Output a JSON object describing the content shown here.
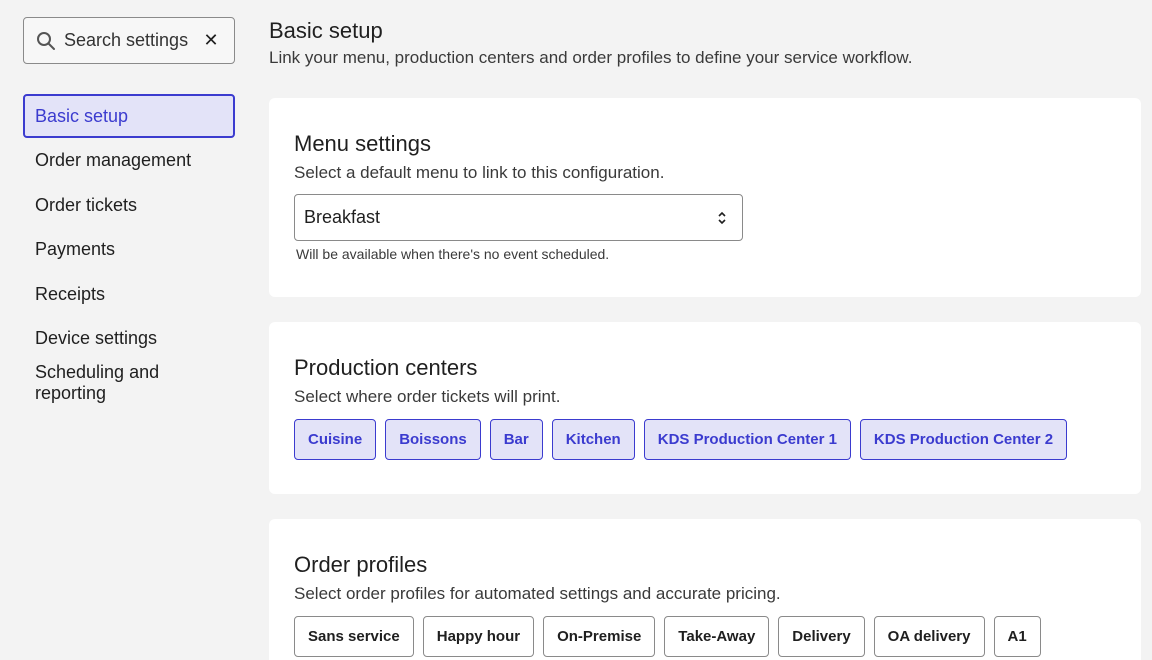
{
  "search": {
    "label": "Search settings",
    "clear_glyph": "✕"
  },
  "sidebar": {
    "items": [
      {
        "label": "Basic setup",
        "active": true
      },
      {
        "label": "Order management"
      },
      {
        "label": "Order tickets"
      },
      {
        "label": "Payments"
      },
      {
        "label": "Receipts"
      },
      {
        "label": "Device settings"
      },
      {
        "label": "Scheduling and reporting"
      }
    ]
  },
  "header": {
    "title": "Basic setup",
    "subtitle": "Link your menu, production centers and order profiles to define your service workflow."
  },
  "menu_settings": {
    "title": "Menu settings",
    "description": "Select a default menu to link to this configuration.",
    "selected_value": "Breakfast",
    "helper": "Will be available when there's no event scheduled."
  },
  "production_centers": {
    "title": "Production centers",
    "description": "Select where order tickets will print.",
    "chips": [
      "Cuisine",
      "Boissons",
      "Bar",
      "Kitchen",
      "KDS Production Center 1",
      "KDS Production Center 2"
    ]
  },
  "order_profiles": {
    "title": "Order profiles",
    "description": "Select order profiles for automated settings and accurate pricing.",
    "chips": [
      "Sans service",
      "Happy hour",
      "On-Premise",
      "Take-Away",
      "Delivery",
      "OA delivery",
      "A1"
    ]
  },
  "colors": {
    "accent": "#3b3bcf",
    "accent_bg": "#e3e3f8",
    "page_bg": "#f3f3f3"
  }
}
